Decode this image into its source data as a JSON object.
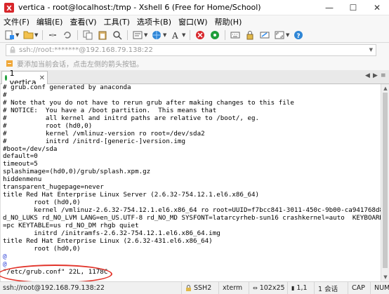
{
  "window": {
    "title": "vertica - root@localhost:/tmp - Xshell 6 (Free for Home/School)",
    "controls": {
      "minimize": "—",
      "maximize": "☐",
      "close": "✕"
    }
  },
  "menu": [
    "文件(F)",
    "编辑(E)",
    "查看(V)",
    "工具(T)",
    "选项卡(B)",
    "窗口(W)",
    "帮助(H)"
  ],
  "toolbar": {
    "icons": [
      "new-session-icon",
      "folder-open-icon",
      "disconnect-icon",
      "reconnect-icon",
      "copy-icon",
      "paste-icon",
      "find-icon",
      "properties-icon",
      "globe-icon",
      "font-icon",
      "color-scheme-icon",
      "xftp-icon",
      "xmanager-icon",
      "keyboard-icon",
      "lock-icon",
      "compose-icon",
      "fullscreen-icon",
      "help-icon"
    ]
  },
  "address": {
    "text": "ssh://root:*******@192.168.79.138:22"
  },
  "note": {
    "text": "要添加当前会话，点击左侧的箭头按钮。"
  },
  "tabs": [
    {
      "label": "1 vertica",
      "status_color": "#1e9e3a"
    }
  ],
  "terminal": {
    "lines": [
      "# grub.conf generated by anaconda",
      "#",
      "# Note that you do not have to rerun grub after making changes to this file",
      "# NOTICE:  You have a /boot partition.  This means that",
      "#          all kernel and initrd paths are relative to /boot/, eg.",
      "#          root (hd0,0)",
      "#          kernel /vmlinuz-version ro root=/dev/sda2",
      "#          initrd /initrd-[generic-]version.img",
      "#boot=/dev/sda",
      "default=0",
      "timeout=5",
      "splashimage=(hd0,0)/grub/splash.xpm.gz",
      "hiddenmenu",
      "transparent_hugepage=never",
      "title Red Hat Enterprise Linux Server (2.6.32-754.12.1.el6.x86_64)",
      "        root (hd0,0)",
      "        kernel /vmlinuz-2.6.32-754.12.1.el6.x86_64 ro root=UUID=f7bcc841-3011-450c-9b00-ca941768d854 r",
      "d_NO_LUKS rd_NO_LVM LANG=en_US.UTF-8 rd_NO_MD SYSFONT=latarcyrheb-sun16 crashkernel=auto  KEYBOARDTYPE",
      "=pc KEYTABLE=us rd_NO_DM rhgb quiet",
      "        initrd /initramfs-2.6.32-754.12.1.el6.x86_64.img",
      "title Red Hat Enterprise Linux (2.6.32-431.el6.x86_64)",
      "        root (hd0,0)",
      "@",
      "@",
      "\"/etc/grub.conf\" 22L, 1178C"
    ],
    "blue_lines": [
      22,
      23
    ],
    "highlighted_line": "transparent_hugepage=never",
    "highlight_color": "#e2342b"
  },
  "status": {
    "connection": "ssh://root@192.168.79.138:22",
    "protocol": "SSH2",
    "term": "xterm",
    "size": "102x25",
    "cursor": "1,1",
    "sessions": "1 会话",
    "caps": "CAP",
    "num": "NUM"
  }
}
